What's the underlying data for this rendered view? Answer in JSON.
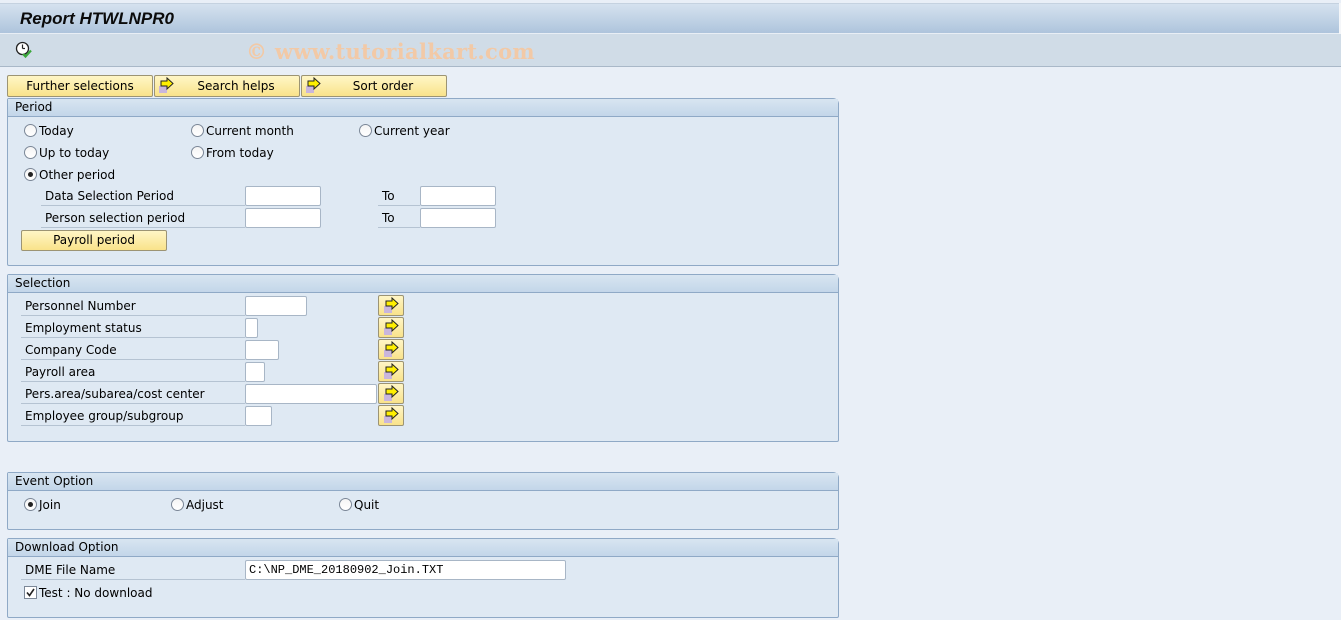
{
  "window": {
    "title": "Report HTWLNPR0",
    "watermark": "© www.tutorialkart.com"
  },
  "toolbar": {
    "execute_icon": "execute-clock-check-icon",
    "buttons": [
      {
        "label": "Further selections",
        "icon": null
      },
      {
        "label": "Search helps",
        "icon": "arrow-right-icon"
      },
      {
        "label": "Sort order",
        "icon": "arrow-right-icon"
      }
    ]
  },
  "period": {
    "title": "Period",
    "options": [
      {
        "label": "Today",
        "selected": false
      },
      {
        "label": "Current month",
        "selected": false
      },
      {
        "label": "Current year",
        "selected": false
      },
      {
        "label": "Up to today",
        "selected": false
      },
      {
        "label": "From today",
        "selected": false
      },
      {
        "label": "Other period",
        "selected": true
      }
    ],
    "data_selection_label": "Data Selection Period",
    "data_selection_from": "",
    "data_selection_to": "",
    "person_selection_label": "Person selection period",
    "person_selection_from": "",
    "person_selection_to": "",
    "to_label": "To",
    "payroll_period_button": "Payroll period"
  },
  "selection": {
    "title": "Selection",
    "fields": [
      {
        "label": "Personnel Number",
        "value": ""
      },
      {
        "label": "Employment status",
        "value": ""
      },
      {
        "label": "Company Code",
        "value": ""
      },
      {
        "label": "Payroll area",
        "value": ""
      },
      {
        "label": "Pers.area/subarea/cost center",
        "value": ""
      },
      {
        "label": "Employee group/subgroup",
        "value": ""
      }
    ],
    "multiple_selection_icon": "arrow-right-icon"
  },
  "event_option": {
    "title": "Event Option",
    "options": [
      {
        "label": "Join",
        "selected": true
      },
      {
        "label": "Adjust",
        "selected": false
      },
      {
        "label": "Quit",
        "selected": false
      }
    ]
  },
  "download_option": {
    "title": "Download Option",
    "dme_file_label": "DME File Name",
    "dme_file_value": "C:\\NP_DME_20180902_Join.TXT",
    "test_checkbox_label": "Test : No download",
    "test_checked": true
  }
}
